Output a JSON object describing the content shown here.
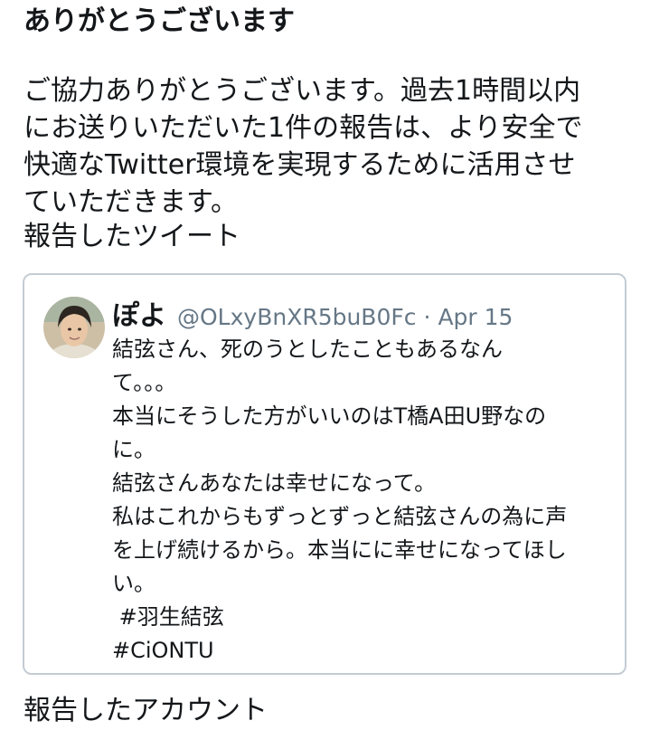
{
  "header": {
    "title": "ありがとうございます"
  },
  "message": {
    "lines": [
      "ご協力ありがとうございます。過去1時間以内",
      "にお送りいただいた1件の報告は、より安全で",
      "快適なTwitter環境を実現するために活用させ",
      "ていただきます。"
    ]
  },
  "reported_tweet_section": {
    "label": "報告したツイート"
  },
  "tweet": {
    "author_name": "ぽよ",
    "author_handle": "@OLxyBnXR5buB0Fc",
    "separator": "·",
    "date": "Apr 15",
    "lines": [
      "結弦さん、死のうとしたこともあるなん",
      "て。。。",
      "本当にそうした方がいいのはT橋A田U野なの",
      "に。",
      "結弦さんあなたは幸せになって。",
      "私はこれからもずっとずっと結弦さんの為に声",
      "を上げ続けるから。本当にに幸せになってほし",
      "い。",
      " #羽生結弦",
      "#CiONTU"
    ]
  },
  "reported_account_section": {
    "label": "報告したアカウント"
  }
}
